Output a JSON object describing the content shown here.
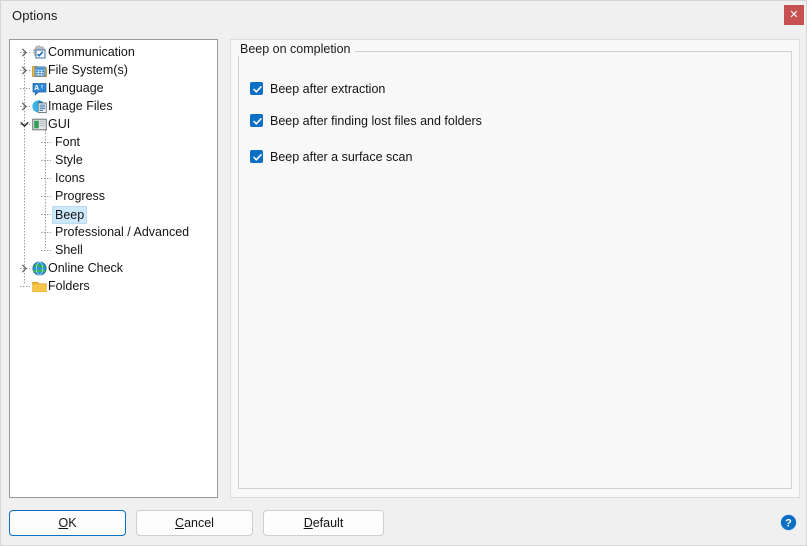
{
  "window": {
    "title": "Options",
    "close_label": "✕"
  },
  "tree": {
    "items": [
      {
        "label": "Communication",
        "level": 0,
        "expander": "collapsed",
        "icon": "communication-icon",
        "selected": false
      },
      {
        "label": "File System(s)",
        "level": 0,
        "expander": "collapsed",
        "icon": "file-systems-icon",
        "selected": false
      },
      {
        "label": "Language",
        "level": 0,
        "expander": "none",
        "icon": "language-icon",
        "selected": false
      },
      {
        "label": "Image Files",
        "level": 0,
        "expander": "collapsed",
        "icon": "image-files-icon",
        "selected": false
      },
      {
        "label": "GUI",
        "level": 0,
        "expander": "expanded",
        "icon": "gui-icon",
        "selected": false
      },
      {
        "label": "Font",
        "level": 1,
        "expander": "none",
        "icon": "none",
        "selected": false
      },
      {
        "label": "Style",
        "level": 1,
        "expander": "none",
        "icon": "none",
        "selected": false
      },
      {
        "label": "Icons",
        "level": 1,
        "expander": "none",
        "icon": "none",
        "selected": false
      },
      {
        "label": "Progress",
        "level": 1,
        "expander": "none",
        "icon": "none",
        "selected": false
      },
      {
        "label": "Beep",
        "level": 1,
        "expander": "none",
        "icon": "none",
        "selected": true
      },
      {
        "label": "Professional / Advanced",
        "level": 1,
        "expander": "none",
        "icon": "none",
        "selected": false
      },
      {
        "label": "Shell",
        "level": 1,
        "expander": "none",
        "icon": "none",
        "selected": false
      },
      {
        "label": "Online Check",
        "level": 0,
        "expander": "collapsed",
        "icon": "online-check-icon",
        "selected": false
      },
      {
        "label": "Folders",
        "level": 0,
        "expander": "none",
        "icon": "folders-icon",
        "selected": false
      }
    ]
  },
  "content": {
    "group_title": "Beep on completion",
    "checkboxes": [
      {
        "label": "Beep after extraction",
        "checked": true
      },
      {
        "label": "Beep after finding lost files and folders",
        "checked": true
      },
      {
        "label": "Beep after a surface scan",
        "checked": true
      }
    ]
  },
  "buttons": {
    "ok": {
      "pre": "",
      "accel": "O",
      "post": "K"
    },
    "cancel": {
      "pre": "",
      "accel": "C",
      "post": "ancel"
    },
    "default": {
      "pre": "",
      "accel": "D",
      "post": "efault"
    }
  },
  "help": {
    "glyph": "?"
  },
  "colors": {
    "accent": "#0b6fc4",
    "selection": "#cde8fa",
    "close": "#c75050",
    "panel": "#f0f0f0",
    "content_bg": "#f8f8f8"
  }
}
